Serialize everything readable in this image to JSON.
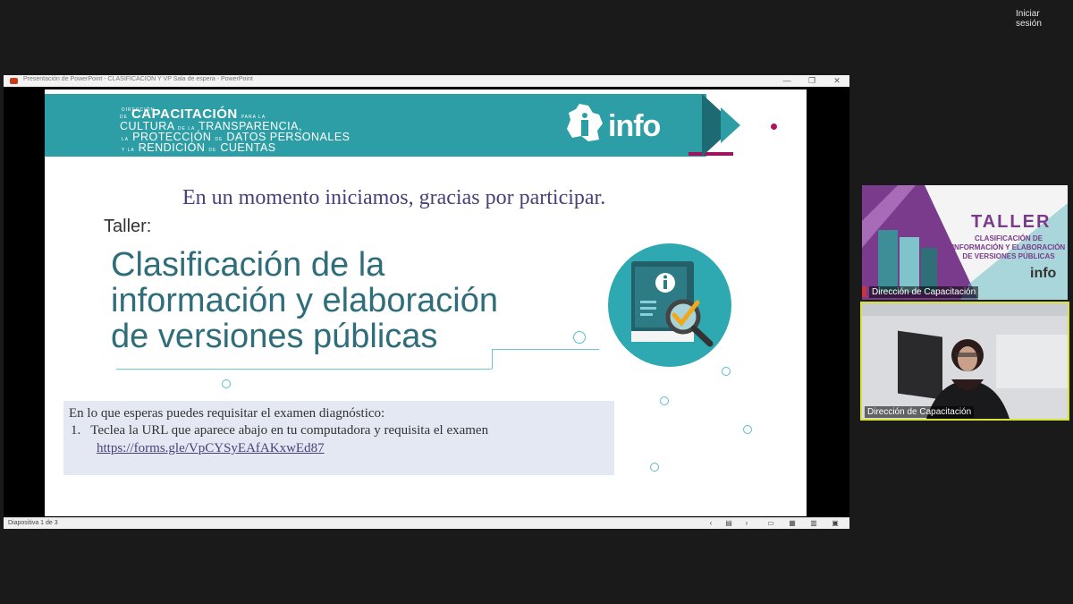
{
  "meeting": {
    "signin_label": "Iniciar sesión"
  },
  "window": {
    "title": "Presentación de PowerPoint  -  CLASIFICACIÓN Y VP Sala de espera - PowerPoint",
    "controls": {
      "minimize": "—",
      "restore": "❐",
      "close": "✕"
    },
    "status_text": "Diapositiva 1 de 3"
  },
  "slide": {
    "banner": {
      "l1_small": "DIRECCIÓN",
      "l2_small": "DE",
      "l2_big": "CAPACITACIÓN",
      "l2_tail": "PARA LA",
      "l3_a": "CULTURA",
      "l3_small": "DE LA",
      "l3_b": "TRANSPARENCIA,",
      "l4_small1": "LA",
      "l4_a": "PROTECCIÓN",
      "l4_small2": "DE",
      "l4_b": "DATOS PERSONALES",
      "l5_small": "Y LA",
      "l5_a": "RENDICIÓN",
      "l5_small2": "DE",
      "l5_b": "CUENTAS",
      "logo_text": "info"
    },
    "subtitle": "En un momento iniciamos, gracias por participar.",
    "taller_label": "Taller:",
    "title_lines": [
      "Clasificación de la",
      "información y elaboración",
      "de versiones públicas"
    ],
    "box": {
      "intro": "En lo que esperas puedes requisitar el examen diagnóstico:",
      "item_number": "1.",
      "item_text": "Teclea la URL que aparece abajo en tu computadora y requisita el examen",
      "link": "https://forms.gle/VpCYSyEAfAKxwEd87"
    }
  },
  "participants": [
    {
      "name": "Dirección de Capacitación",
      "content": {
        "title": "TALLER",
        "subtitle": "CLASIFICACIÓN DE INFORMACIÓN Y ELABORACIÓN DE VERSIONES PÚBLICAS",
        "logo": "info"
      }
    },
    {
      "name": "Dirección de Capacitación"
    }
  ],
  "colors": {
    "banner_teal": "#2e9ea6",
    "accent_pink": "#a0135e",
    "title_teal": "#2f6d7a",
    "subtitle_purple": "#4a3f7a",
    "box_bg": "#e3e8f3",
    "active_speaker": "#d6e23a"
  }
}
